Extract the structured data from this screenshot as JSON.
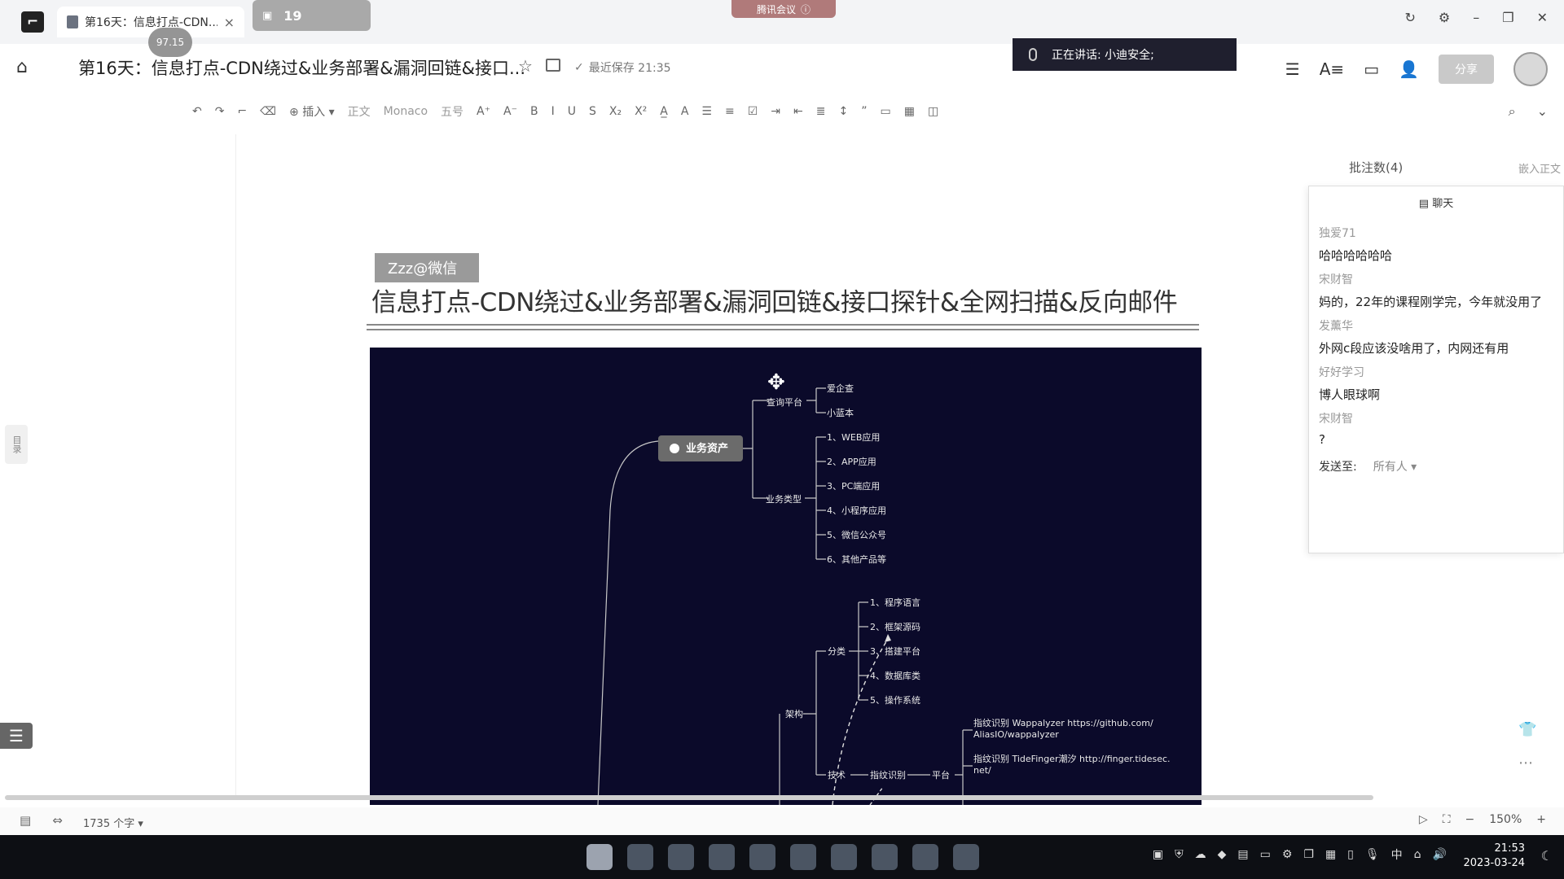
{
  "tabs": {
    "doc_tab_label": "第16天：信息打点-CDN...",
    "timer_bubble": "97.15",
    "second_tab_count": "19",
    "meeting_tab_label": "腾讯会议"
  },
  "header": {
    "doc_title": "第16天：信息打点-CDN绕过&业务部署&漏洞回链&接口...",
    "save_status": "最近保存 21:35",
    "speaking": "正在讲话: 小迪安全;",
    "share_label": "分享"
  },
  "toolbar": {
    "insert_label": "插入",
    "style_label": "正文",
    "font_label": "Monaco",
    "size_label": "五号"
  },
  "document": {
    "watermark": "Zzz@微信",
    "heading": "信息打点-CDN绕过&业务部署&漏洞回链&接口探针&全网扫描&反向邮件"
  },
  "mindmap": {
    "root": "业务资产",
    "query_platform": "查询平台",
    "query_items": [
      "爱企查",
      "小蓝本"
    ],
    "business_type": "业务类型",
    "business_items": [
      "1、WEB应用",
      "2、APP应用",
      "3、PC端应用",
      "4、小程序应用",
      "5、微信公众号",
      "6、其他产品等"
    ],
    "architecture": "架构",
    "classification": "分类",
    "class_items": [
      "1、程序语言",
      "2、框架源码",
      "3、搭建平台",
      "4、数据库类",
      "5、操作系统"
    ],
    "tech": "技术",
    "fingerprint": "指纹识别",
    "platform": "平台",
    "fp_items": [
      [
        "指纹识别 Wappalyzer https://github.com/",
        "AliasIO/wappalyzer"
      ],
      [
        "指纹识别 TideFinger潮汐 http://finger.tidesec.",
        "net/"
      ]
    ]
  },
  "right_panel": {
    "comments_count": "批注数(4)",
    "insert_to_body": "嵌入正文",
    "chat_title": "聊天",
    "messages": [
      {
        "name": "独爱71",
        "text": "哈哈哈哈哈哈"
      },
      {
        "name": "宋财智",
        "text": "妈的，22年的课程刚学完，今年就没用了"
      },
      {
        "name": "发薰华",
        "text": "外网c段应该没啥用了，内网还有用"
      },
      {
        "name": "好好学习",
        "text": "博人眼球啊"
      },
      {
        "name": "宋财智",
        "text": "?"
      }
    ],
    "send_to_label": "发送至:",
    "send_to_value": "所有人"
  },
  "toc_label": "目录",
  "status": {
    "word_count": "1735 个字",
    "zoom": "150%"
  },
  "taskbar": {
    "ime": "中",
    "time": "21:53",
    "date": "2023-03-24"
  }
}
